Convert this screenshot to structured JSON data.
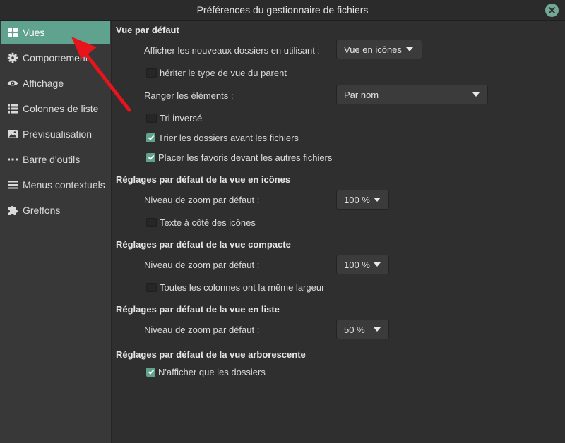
{
  "window": {
    "title": "Préférences du gestionnaire de fichiers"
  },
  "sidebar": {
    "items": [
      {
        "label": "Vues",
        "icon": "grid-icon",
        "active": true
      },
      {
        "label": "Comportement",
        "icon": "gear-icon"
      },
      {
        "label": "Affichage",
        "icon": "eye-icon"
      },
      {
        "label": "Colonnes de liste",
        "icon": "list-columns-icon"
      },
      {
        "label": "Prévisualisation",
        "icon": "image-icon"
      },
      {
        "label": "Barre d'outils",
        "icon": "dots-icon"
      },
      {
        "label": "Menus contextuels",
        "icon": "menu-icon"
      },
      {
        "label": "Greffons",
        "icon": "puzzle-icon"
      }
    ]
  },
  "default_view": {
    "heading": "Vue par défaut",
    "new_folders_label": "Afficher les nouveaux dossiers en utilisant :",
    "new_folders_value": "Vue en icônes",
    "inherit_label": "hériter le type de vue du parent",
    "inherit_checked": false,
    "sort_label": "Ranger les éléments :",
    "sort_value": "Par nom",
    "reverse_label": "Tri inversé",
    "reverse_checked": false,
    "folders_first_label": "Trier les dossiers avant les fichiers",
    "folders_first_checked": true,
    "favorites_first_label": "Placer les favoris devant les autres fichiers",
    "favorites_first_checked": true
  },
  "icon_view": {
    "heading": "Réglages par défaut de la vue en icônes",
    "zoom_label": "Niveau de zoom par défaut :",
    "zoom_value": "100 %",
    "text_beside_label": "Texte à côté des icônes",
    "text_beside_checked": false
  },
  "compact_view": {
    "heading": "Réglages par défaut de la vue compacte",
    "zoom_label": "Niveau de zoom par défaut :",
    "zoom_value": "100 %",
    "same_width_label": "Toutes les colonnes ont la même largeur",
    "same_width_checked": false
  },
  "list_view": {
    "heading": "Réglages par défaut de la vue en liste",
    "zoom_label": "Niveau de zoom par défaut :",
    "zoom_value": "50 %"
  },
  "tree_view": {
    "heading": "Réglages par défaut de la vue arborescente",
    "folders_only_label": "N'afficher que les dossiers",
    "folders_only_checked": true
  },
  "colors": {
    "accent": "#5fa28d",
    "annotation_arrow": "#e8141c"
  }
}
